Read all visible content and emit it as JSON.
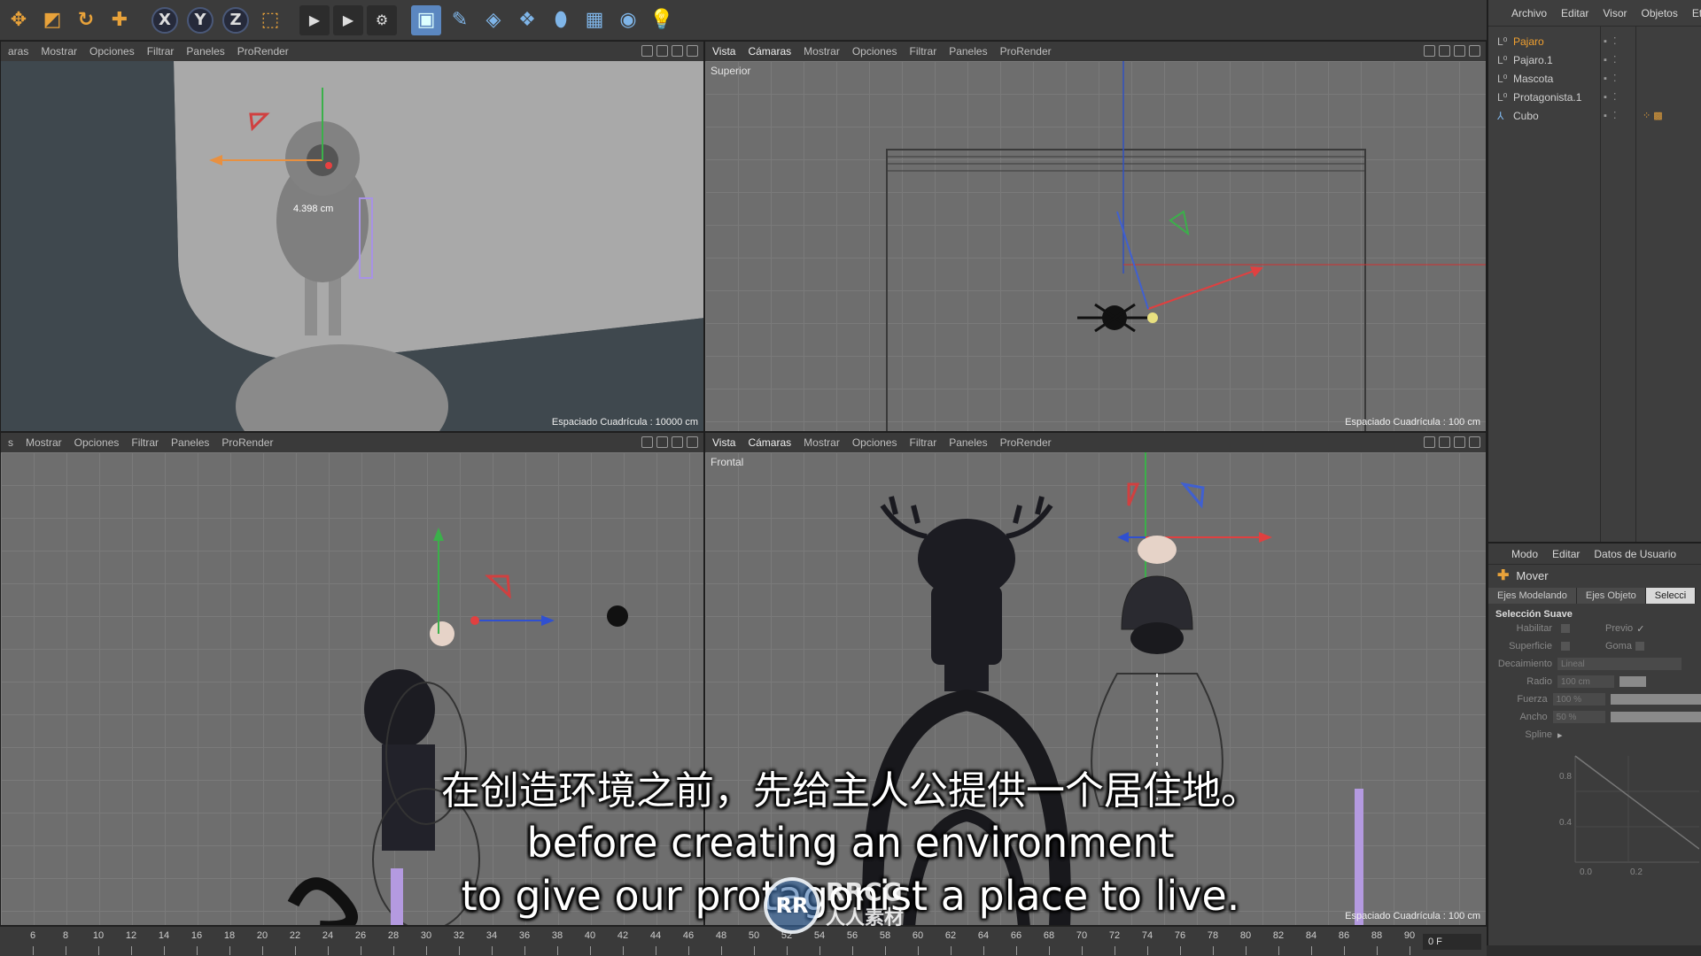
{
  "toolbar": {
    "tools": [
      {
        "name": "move-tool-icon",
        "glyph": "✥"
      },
      {
        "name": "scale-tool-icon",
        "glyph": "◩"
      },
      {
        "name": "rotate-tool-icon",
        "glyph": "↻"
      },
      {
        "name": "add-tool-icon",
        "glyph": "✚"
      }
    ],
    "axes": [
      "X",
      "Y",
      "Z"
    ],
    "coord_icon": "⬚"
  },
  "viewports": {
    "perspective": {
      "menu": [
        "aras",
        "Mostrar",
        "Opciones",
        "Filtrar",
        "Paneles",
        "ProRender"
      ],
      "grid_text": "Espaciado Cuadrícula : 10000 cm",
      "measure": "4.398 cm"
    },
    "top": {
      "menu": [
        "Vista",
        "Cámaras",
        "Mostrar",
        "Opciones",
        "Filtrar",
        "Paneles",
        "ProRender"
      ],
      "label": "Superior",
      "grid_text": "Espaciado Cuadrícula : 100 cm"
    },
    "side": {
      "menu": [
        "s",
        "Mostrar",
        "Opciones",
        "Filtrar",
        "Paneles",
        "ProRender"
      ]
    },
    "front": {
      "menu": [
        "Vista",
        "Cámaras",
        "Mostrar",
        "Opciones",
        "Filtrar",
        "Paneles",
        "ProRender"
      ],
      "label": "Frontal",
      "grid_text": "Espaciado Cuadrícula : 100 cm"
    }
  },
  "object_manager": {
    "menu": [
      "Archivo",
      "Editar",
      "Visor",
      "Objetos",
      "Et"
    ],
    "objects": [
      {
        "label": "Pajaro",
        "selected": true
      },
      {
        "label": "Pajaro.1",
        "selected": false
      },
      {
        "label": "Mascota",
        "selected": false
      },
      {
        "label": "Protagonista.1",
        "selected": false
      },
      {
        "label": "Cubo",
        "selected": false
      }
    ]
  },
  "attribute_manager": {
    "menu": [
      "Modo",
      "Editar",
      "Datos de Usuario"
    ],
    "tool_title": "Mover",
    "tabs": [
      "Ejes Modelando",
      "Ejes Objeto",
      "Selecci"
    ],
    "section": "Selección Suave",
    "habilitar": "Habilitar",
    "previo": "Previo",
    "superficie": "Superficie",
    "goma": "Goma",
    "decaimiento_label": "Decaimiento",
    "decaimiento_value": "Lineal",
    "radio_label": "Radio",
    "radio_value": "100 cm",
    "fuerza_label": "Fuerza",
    "fuerza_value": "100 %",
    "ancho_label": "Ancho",
    "ancho_value": "50 %",
    "spline_label": "Spline",
    "spline_y": [
      "0.8",
      "0.4"
    ],
    "spline_x": [
      "0.0",
      "0.2"
    ]
  },
  "timeline": {
    "ticks": [
      "6",
      "8",
      "10",
      "12",
      "14",
      "16",
      "18",
      "20",
      "22",
      "24",
      "26",
      "28",
      "30",
      "32",
      "34",
      "36",
      "38",
      "40",
      "42",
      "44",
      "46",
      "48",
      "50",
      "52",
      "54",
      "56",
      "58",
      "60",
      "62",
      "64",
      "66",
      "68",
      "70",
      "72",
      "74",
      "76",
      "78",
      "80",
      "82",
      "84",
      "86",
      "88",
      "90"
    ],
    "frame": "0 F"
  },
  "subtitles": {
    "zh": "在创造环境之前，先给主人公提供一个居住地。",
    "en1": "before creating an environment",
    "en2": "to give our protagonist a place to live."
  },
  "watermark": {
    "logo": "RR",
    "line1": "RRCG",
    "line2": "人人素材"
  }
}
